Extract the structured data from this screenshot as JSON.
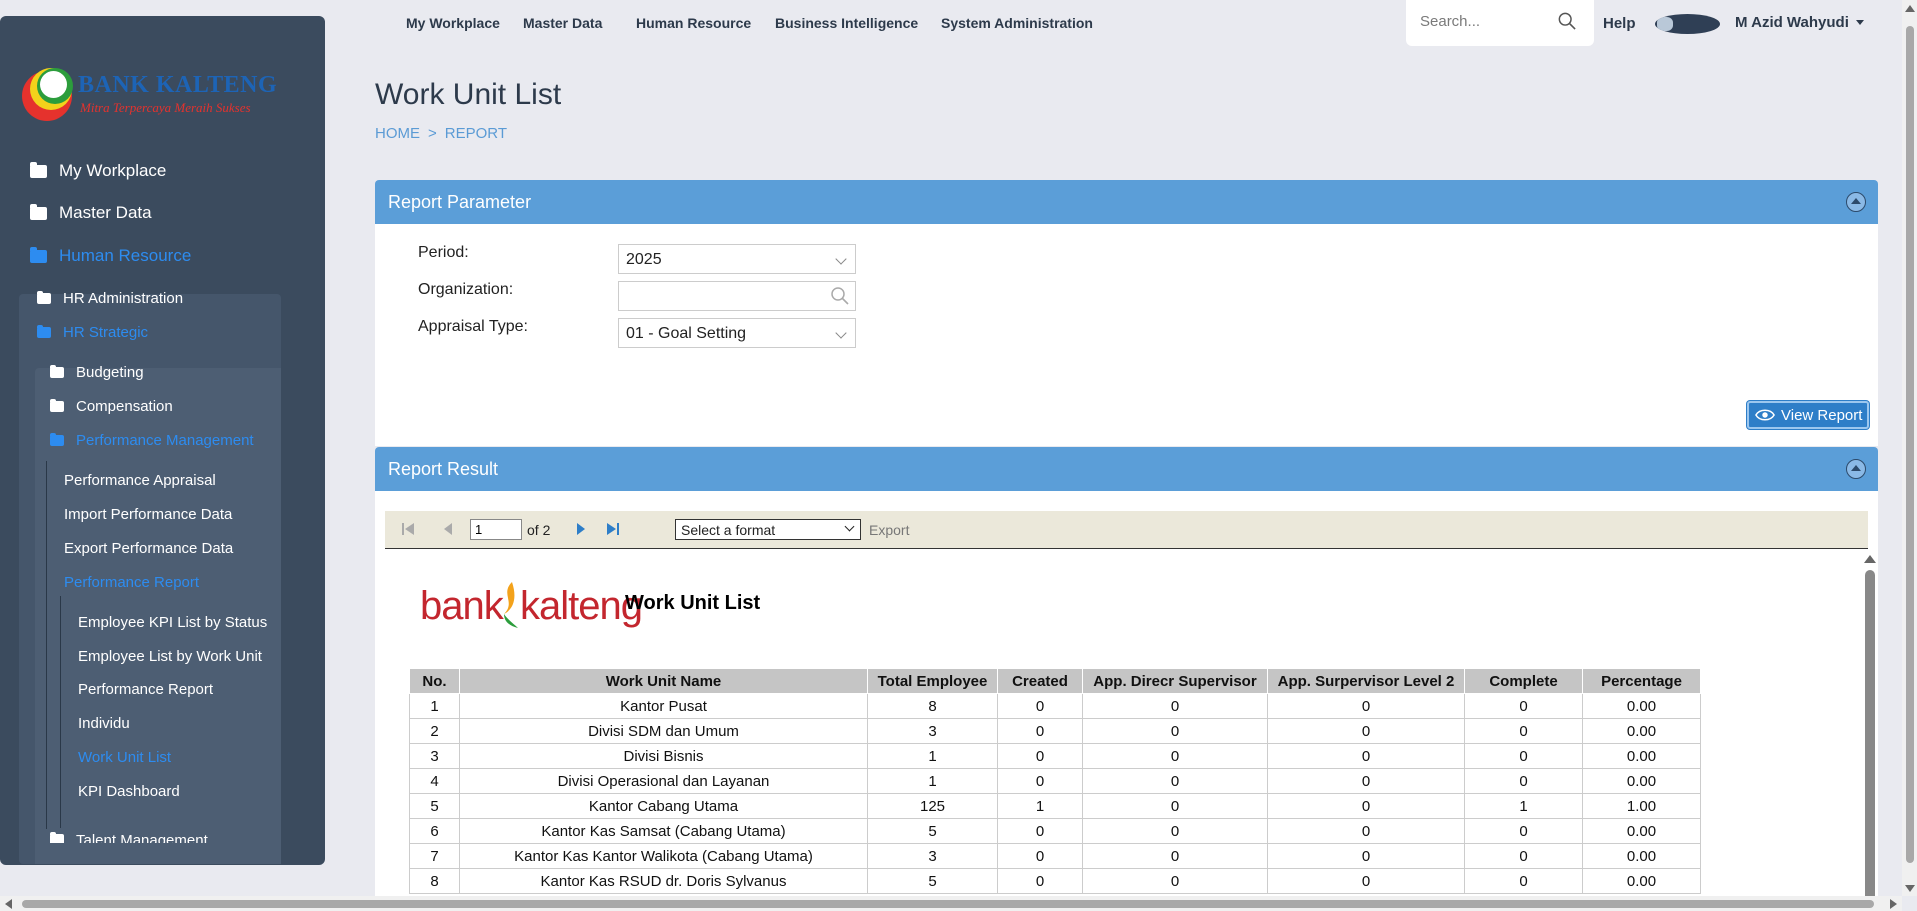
{
  "brand": {
    "name": "BANK KALTENG",
    "tagline": "Mitra Terpercaya Meraih Sukses",
    "colors": {
      "red": "#e5322d",
      "yellow": "#f3d21b",
      "green": "#2c9d3c",
      "blue": "#1d64b6"
    }
  },
  "topnav": {
    "items": [
      "My Workplace",
      "Master Data",
      "Human Resource",
      "Business Intelligence",
      "System Administration"
    ],
    "search_placeholder": "Search...",
    "help": "Help",
    "user_name": "M Azid Wahyudi"
  },
  "sidebar": {
    "top_items": [
      "My Workplace",
      "Master Data",
      "Human Resource"
    ],
    "hr_items": [
      "HR Administration",
      "HR Strategic"
    ],
    "strategic_items": [
      "Budgeting",
      "Compensation",
      "Performance Management"
    ],
    "pm_items": [
      "Performance Appraisal",
      "Import Performance Data",
      "Export Performance Data",
      "Performance Report"
    ],
    "report_items": [
      "Employee KPI List by Status",
      "Employee List by Work Unit",
      "Performance Report",
      "Individu",
      "Work Unit List",
      "KPI Dashboard"
    ],
    "partial_item": "Talent Management",
    "active_color": "#2d8cf0"
  },
  "page": {
    "title": "Work Unit List",
    "breadcrumb": [
      "HOME",
      ">",
      "REPORT"
    ]
  },
  "param_panel": {
    "title": "Report Parameter",
    "period_label": "Period:",
    "period_value": "2025",
    "org_label": "Organization:",
    "org_value": "",
    "appraisal_label": "Appraisal Type:",
    "appraisal_value": "01 - Goal Setting",
    "view_button": "View Report"
  },
  "result_panel": {
    "title": "Report Result",
    "toolbar": {
      "page_value": "1",
      "of_pages": "of 2",
      "format_placeholder": "Select a format",
      "export": "Export"
    },
    "report": {
      "logo_left": "bank",
      "logo_right": "kalteng",
      "title": "Work Unit List",
      "columns": [
        "No.",
        "Work Unit Name",
        "Total Employee",
        "Created",
        "App. Direcr Supervisor",
        "App. Surpervisor Level 2",
        "Complete",
        "Percentage"
      ],
      "rows": [
        [
          "1",
          "Kantor Pusat",
          "8",
          "0",
          "0",
          "0",
          "0",
          "0.00"
        ],
        [
          "2",
          "Divisi SDM dan Umum",
          "3",
          "0",
          "0",
          "0",
          "0",
          "0.00"
        ],
        [
          "3",
          "Divisi Bisnis",
          "1",
          "0",
          "0",
          "0",
          "0",
          "0.00"
        ],
        [
          "4",
          "Divisi Operasional dan Layanan",
          "1",
          "0",
          "0",
          "0",
          "0",
          "0.00"
        ],
        [
          "5",
          "Kantor Cabang Utama",
          "125",
          "1",
          "0",
          "0",
          "1",
          "1.00"
        ],
        [
          "6",
          "Kantor Kas Samsat (Cabang Utama)",
          "5",
          "0",
          "0",
          "0",
          "0",
          "0.00"
        ],
        [
          "7",
          "Kantor Kas Kantor Walikota (Cabang Utama)",
          "3",
          "0",
          "0",
          "0",
          "0",
          "0.00"
        ],
        [
          "8",
          "Kantor Kas RSUD dr. Doris Sylvanus",
          "5",
          "0",
          "0",
          "0",
          "0",
          "0.00"
        ]
      ]
    }
  }
}
